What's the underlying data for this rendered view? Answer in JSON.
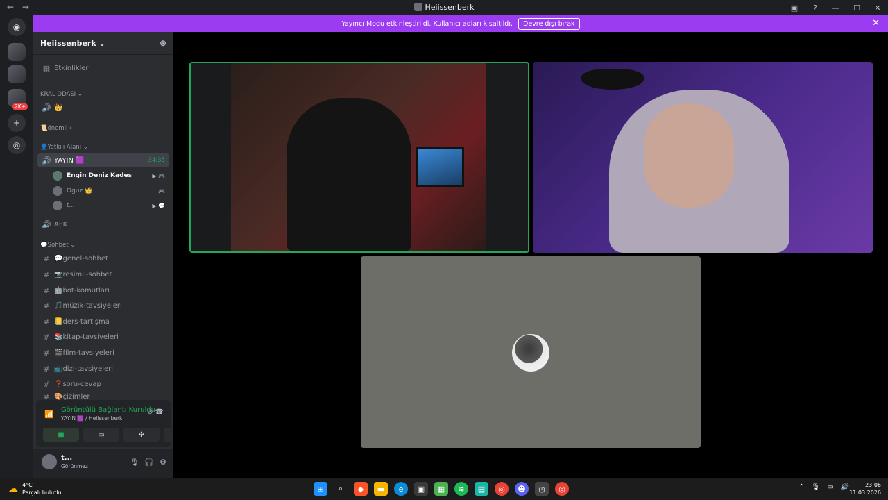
{
  "window": {
    "title": "Heiissenberk",
    "back": "←",
    "forward": "→",
    "controls": [
      "▣",
      "?",
      "—",
      "☐",
      "✕"
    ]
  },
  "banner": {
    "text": "Yayıncı Modu etkinleştirildi. Kullanıcı adları kısaltıldı.",
    "button": "Devre dışı bırak",
    "close": "✕"
  },
  "servers": {
    "badge": "2K+"
  },
  "sidebar": {
    "server_name": "Heiissenberk ⌄",
    "events": "Etkinlikler",
    "categories": {
      "kral": "KRAL ODASI ⌄",
      "onemli": "📜önemli ›",
      "yetkili": "👤Yetkili Alanı ⌄",
      "sohbet": "💬Sohbet ⌄"
    },
    "kral_channel": "👑",
    "active_channel": "YAYIN 🟪",
    "timer": "34:35",
    "members": [
      {
        "name": "Engin Deniz Kadeş",
        "icons": "▶ 🎮"
      },
      {
        "name": "Oğuz 👑",
        "icons": "🎮"
      },
      {
        "name": "t...",
        "icons": "▶ 💬"
      }
    ],
    "afk": "AFK",
    "text_channels": [
      "💬genel-sohbet",
      "📷resimli-sohbet",
      "🤖bot-komutları",
      "🎵müzik-tavsiyeleri",
      "📒ders-tartışma",
      "📚kitap-tavsiyeleri",
      "🎬film-tavsiyeleri",
      "📺dizi-tavsiyeleri",
      "❓soru-cevap",
      "🎨çizimler"
    ]
  },
  "voice_panel": {
    "status": "Görüntülü Bağlantı Kuruldu",
    "sub": "YAYIN 🟪 / Heiissenberk"
  },
  "user": {
    "name": "t...",
    "status": "Görünmez"
  },
  "taskbar": {
    "temp": "4°C",
    "weather": "Parçalı bulutlu",
    "time": "23:06",
    "date": "11.03.2026"
  }
}
